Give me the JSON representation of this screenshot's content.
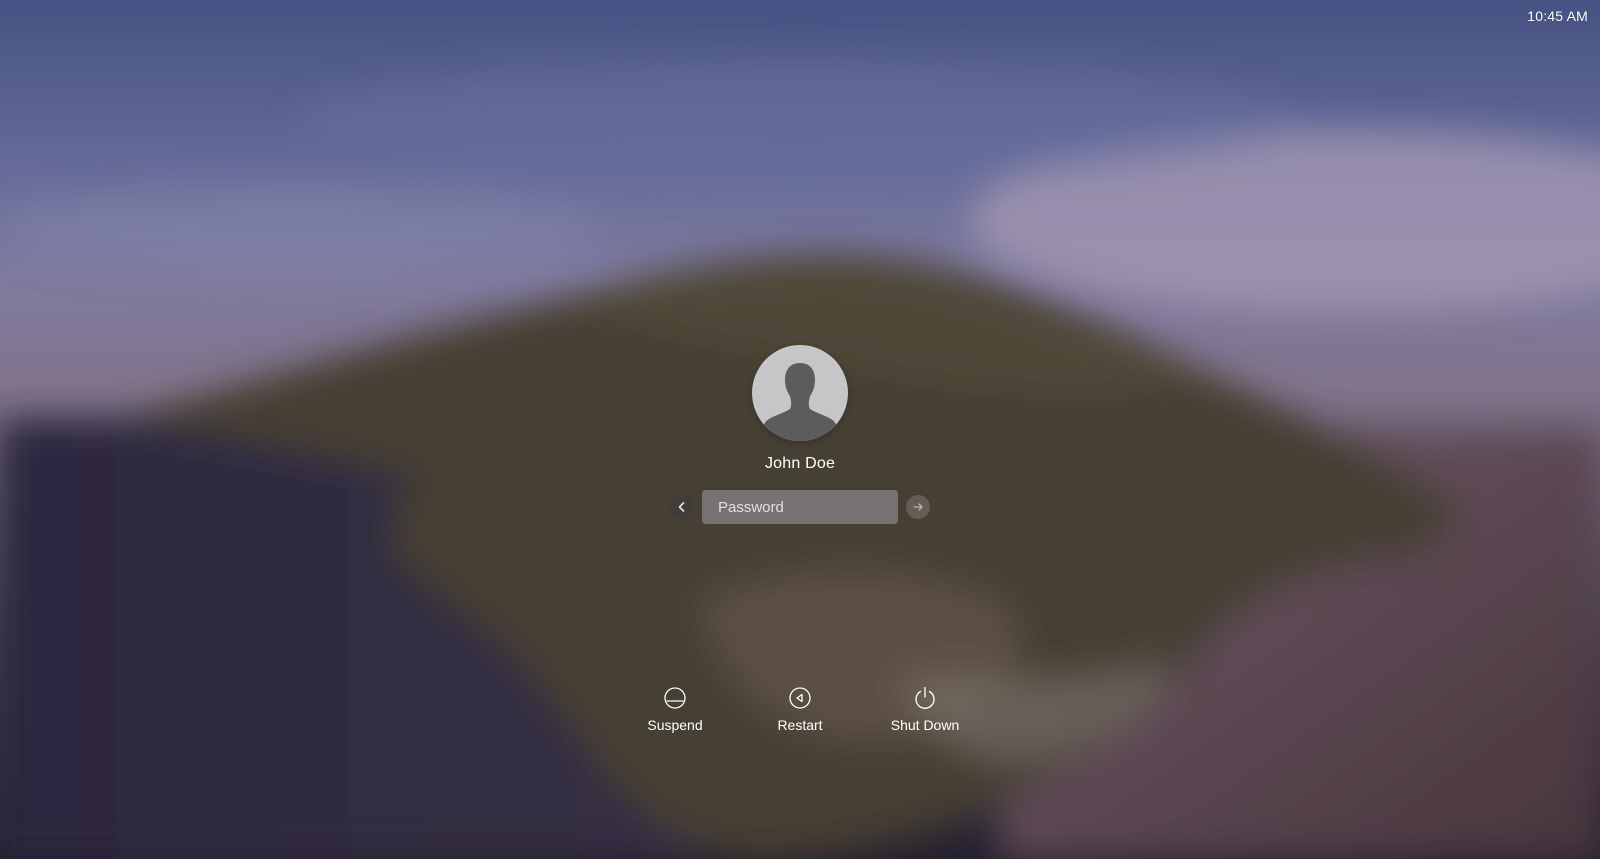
{
  "status_bar": {
    "clock": "10:45 AM"
  },
  "user": {
    "name": "John Doe",
    "avatar_icon": "person-silhouette-icon"
  },
  "password_field": {
    "placeholder": "Password",
    "value": ""
  },
  "buttons": {
    "back_icon": "chevron-left-icon",
    "submit_icon": "arrow-right-icon"
  },
  "actions": [
    {
      "label": "Suspend",
      "icon": "suspend-icon"
    },
    {
      "label": "Restart",
      "icon": "restart-icon"
    },
    {
      "label": "Shut Down",
      "icon": "power-icon"
    }
  ],
  "colors": {
    "text": "#ffffff",
    "avatar_bg": "#c6c6c8",
    "avatar_figure": "#5c5c5e"
  }
}
